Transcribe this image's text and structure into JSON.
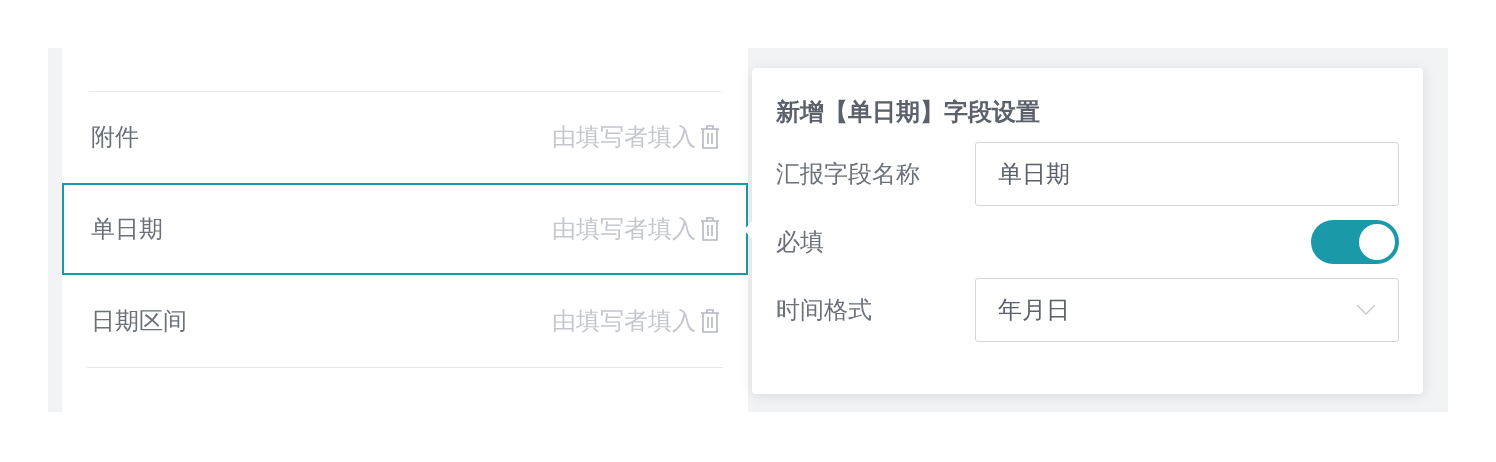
{
  "fields": [
    {
      "name": "附件",
      "hint": "由填写者填入",
      "selected": false
    },
    {
      "name": "单日期",
      "hint": "由填写者填入",
      "selected": true
    },
    {
      "name": "日期区间",
      "hint": "由填写者填入",
      "selected": false
    }
  ],
  "settings": {
    "title": "新增【单日期】字段设置",
    "name_label": "汇报字段名称",
    "name_value": "单日期",
    "required_label": "必填",
    "required_on": true,
    "format_label": "时间格式",
    "format_value": "年月日"
  }
}
